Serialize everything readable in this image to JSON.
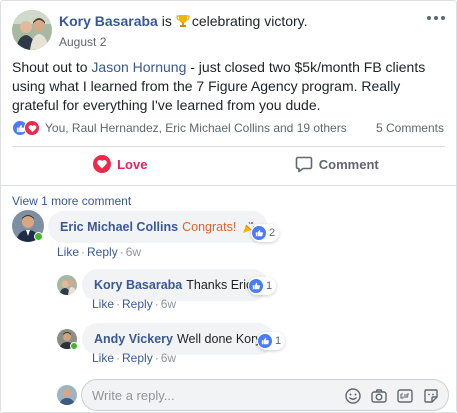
{
  "post": {
    "author": "Kory Basaraba",
    "status_prefix": "is",
    "status_activity": "celebrating victory.",
    "date": "August 2",
    "text_before": "Shout out to ",
    "mention": "Jason Hornung",
    "text_after": " - just closed two $5k/month FB clients using what I learned from the 7 Figure Agency program. Really grateful for everything I've learned from you dude.",
    "reaction_names": "You, Raul Hernandez, Eric Michael Collins and 19 others",
    "comment_count": "5 Comments",
    "love_label": "Love",
    "comment_label": "Comment"
  },
  "view_more": "View 1 more comment",
  "comments": [
    {
      "author": "Eric Michael Collins",
      "text": "Congrats!",
      "likes": "2",
      "like": "Like",
      "reply": "Reply",
      "time": "6w"
    },
    {
      "author": "Kory Basaraba",
      "text": "Thanks Eric!",
      "likes": "1",
      "like": "Like",
      "reply": "Reply",
      "time": "6w"
    },
    {
      "author": "Andy Vickery",
      "text": "Well done Kory",
      "likes": "1",
      "like": "Like",
      "reply": "Reply",
      "time": "6w"
    }
  ],
  "reply_input": {
    "placeholder": "Write a reply...",
    "icons": [
      "smiley-icon",
      "camera-icon",
      "gif-icon",
      "sticker-icon"
    ]
  },
  "colors": {
    "link_blue": "#385898",
    "love_red": "#e0245e",
    "like_blue": "#4a7cf6",
    "congrats_orange": "#e4612c",
    "online_green": "#42b72a"
  }
}
